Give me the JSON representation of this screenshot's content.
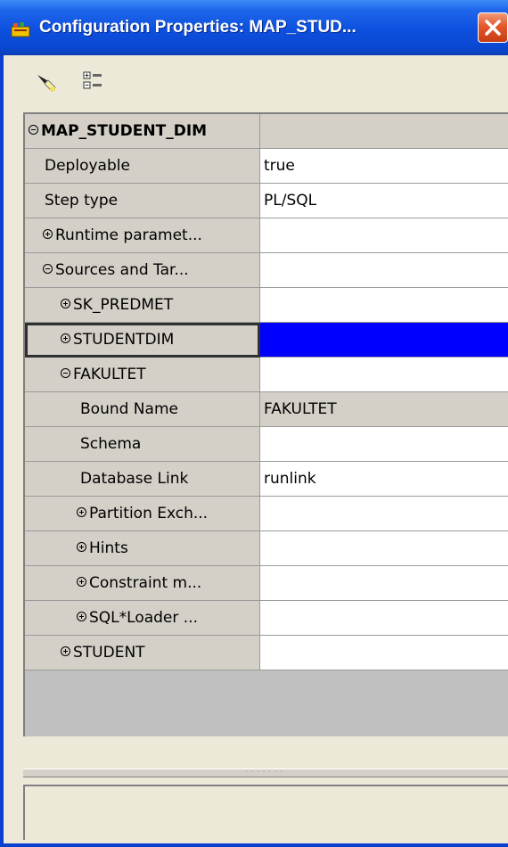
{
  "window": {
    "title": "Configuration Properties: MAP_STUD..."
  },
  "colors": {
    "titlebar": "#0a48d2",
    "selection": "#0000ff",
    "grid_bg": "#d4d0c8"
  },
  "toolbar": {
    "icons": [
      "highlight-icon",
      "expand-collapse-icon"
    ]
  },
  "properties": {
    "root": {
      "name": "MAP_STUDENT_DIM",
      "value": ""
    },
    "deployable": {
      "name": "Deployable",
      "value": "true"
    },
    "step_type": {
      "name": "Step type",
      "value": "PL/SQL"
    },
    "runtime": {
      "name": "Runtime paramet...",
      "value": ""
    },
    "sources": {
      "name": "Sources and Tar...",
      "value": ""
    },
    "sk_predmet": {
      "name": "SK_PREDMET",
      "value": ""
    },
    "studentdim": {
      "name": "STUDENTDIM",
      "value": ""
    },
    "fakultet": {
      "name": "FAKULTET",
      "value": ""
    },
    "bound_name": {
      "name": "Bound Name",
      "value": "FAKULTET"
    },
    "schema": {
      "name": "Schema",
      "value": ""
    },
    "db_link": {
      "name": "Database Link",
      "value": "runlink"
    },
    "partition": {
      "name": "Partition Exch...",
      "value": ""
    },
    "hints": {
      "name": "Hints",
      "value": ""
    },
    "constraint": {
      "name": "Constraint m...",
      "value": ""
    },
    "sqlloader": {
      "name": "SQL*Loader ...",
      "value": ""
    },
    "student": {
      "name": "STUDENT",
      "value": ""
    }
  }
}
